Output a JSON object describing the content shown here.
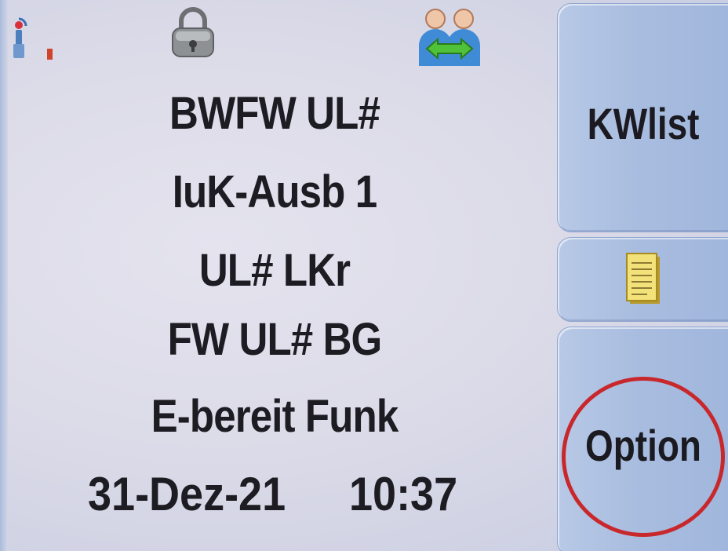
{
  "status_bar": {
    "radio_icon": "radio-signal-icon",
    "lock_icon": "padlock-icon",
    "group_icon": "group-call-icon"
  },
  "display_lines": [
    "BWFW UL#",
    "IuK-Ausb 1",
    "UL# LKr",
    "FW UL# BG",
    "E-bereit Funk"
  ],
  "datetime": {
    "date": "31-Dez-21",
    "time": "10:37"
  },
  "softkeys": {
    "top_label": "KWlist",
    "middle_icon": "notepad-icon",
    "bottom_label": "Option"
  },
  "colors": {
    "text": "#1d1c22",
    "softkey_bg": "#a9bde0",
    "highlight": "#c8282c"
  }
}
